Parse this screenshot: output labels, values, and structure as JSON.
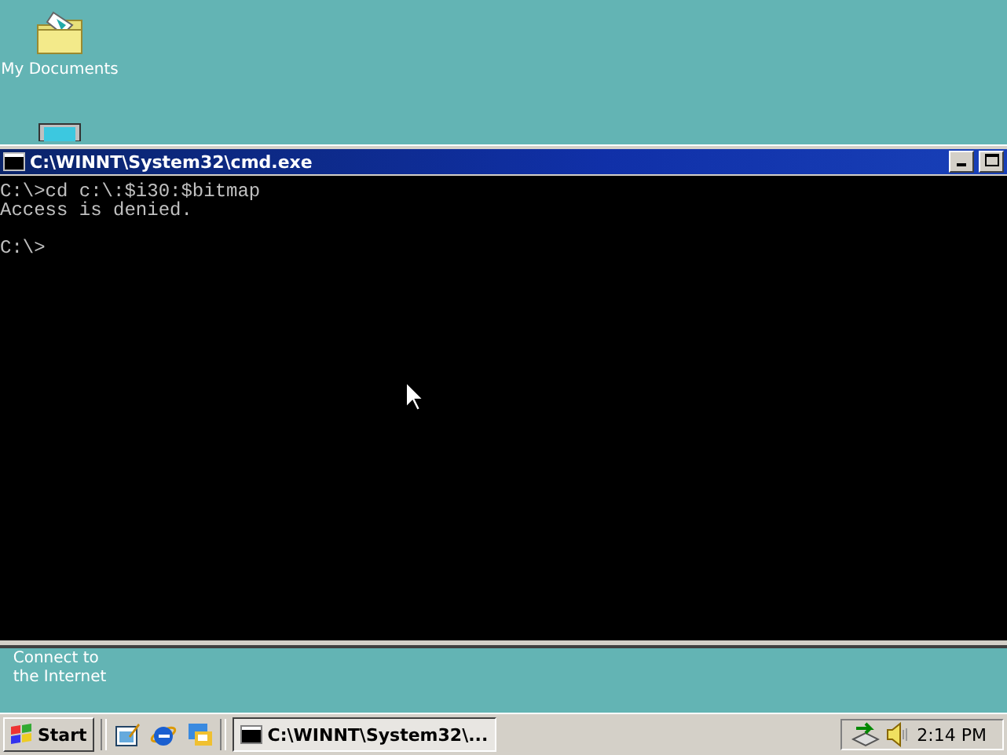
{
  "desktop_icons": [
    {
      "kind": "folder",
      "label": "My Documents"
    },
    {
      "kind": "monitor"
    },
    {
      "kind": "label_only",
      "label": "Connect to\nthe Internet"
    }
  ],
  "window": {
    "title": "C:\\WINNT\\System32\\cmd.exe",
    "console_blocks": [
      [
        "C:\\>cd c:\\:$i30:$bitmap",
        "Access is denied."
      ],
      [
        "C:\\>"
      ]
    ]
  },
  "taskbar": {
    "start": "Start",
    "tasks": [
      {
        "label": "C:\\WINNT\\System32\\...",
        "selected": true
      }
    ],
    "clock": "2:14 PM"
  }
}
